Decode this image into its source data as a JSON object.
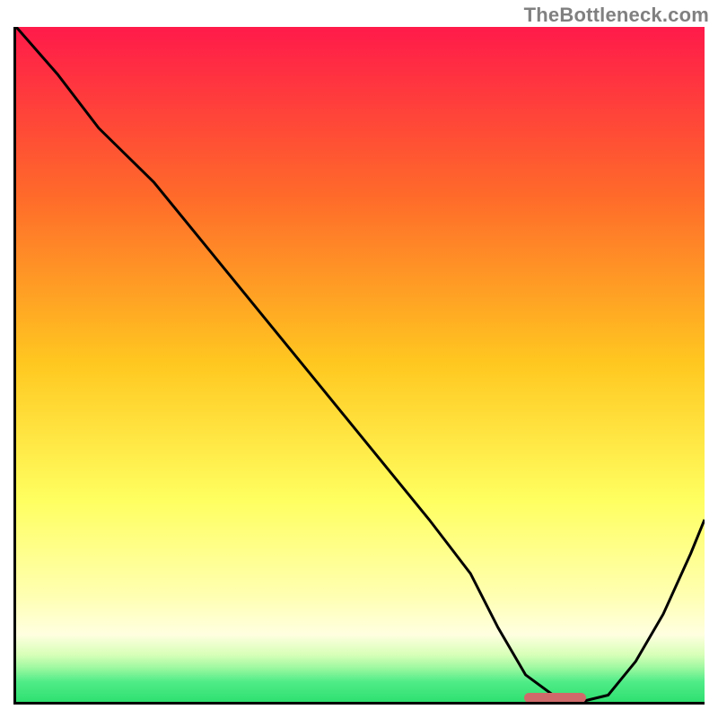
{
  "watermark": "TheBottleneck.com",
  "colors": {
    "top": "#ff1a4a",
    "mid_warm": "#ff8a2a",
    "mid_yellow": "#ffe028",
    "pale_yellow": "#ffffa8",
    "near_bottom_yellow": "#ffffc8",
    "green": "#2fe070",
    "axis": "#000000",
    "curve": "#000000",
    "marker": "#d06a6a"
  },
  "chart_data": {
    "type": "line",
    "title": "",
    "xlabel": "",
    "ylabel": "",
    "xlim": [
      0,
      100
    ],
    "ylim": [
      0,
      100
    ],
    "x": [
      0,
      6,
      12,
      20,
      28,
      36,
      44,
      52,
      60,
      66,
      70,
      74,
      78,
      82,
      86,
      90,
      94,
      98,
      100
    ],
    "y": [
      100,
      93,
      85,
      77,
      67,
      57,
      47,
      37,
      27,
      19,
      11,
      4,
      1,
      0,
      1,
      6,
      13,
      22,
      27
    ],
    "optimum_x_range": [
      74,
      82
    ],
    "optimum_y": 0,
    "gradient_stops": [
      {
        "pct": 0,
        "hex": "#ff1a4a"
      },
      {
        "pct": 25,
        "hex": "#ff6a2a"
      },
      {
        "pct": 50,
        "hex": "#ffc820"
      },
      {
        "pct": 70,
        "hex": "#ffff60"
      },
      {
        "pct": 84,
        "hex": "#ffffb0"
      },
      {
        "pct": 90,
        "hex": "#ffffe0"
      },
      {
        "pct": 93,
        "hex": "#d8ffb8"
      },
      {
        "pct": 95,
        "hex": "#9cf8a0"
      },
      {
        "pct": 97,
        "hex": "#50ec88"
      },
      {
        "pct": 100,
        "hex": "#2fe070"
      }
    ]
  }
}
